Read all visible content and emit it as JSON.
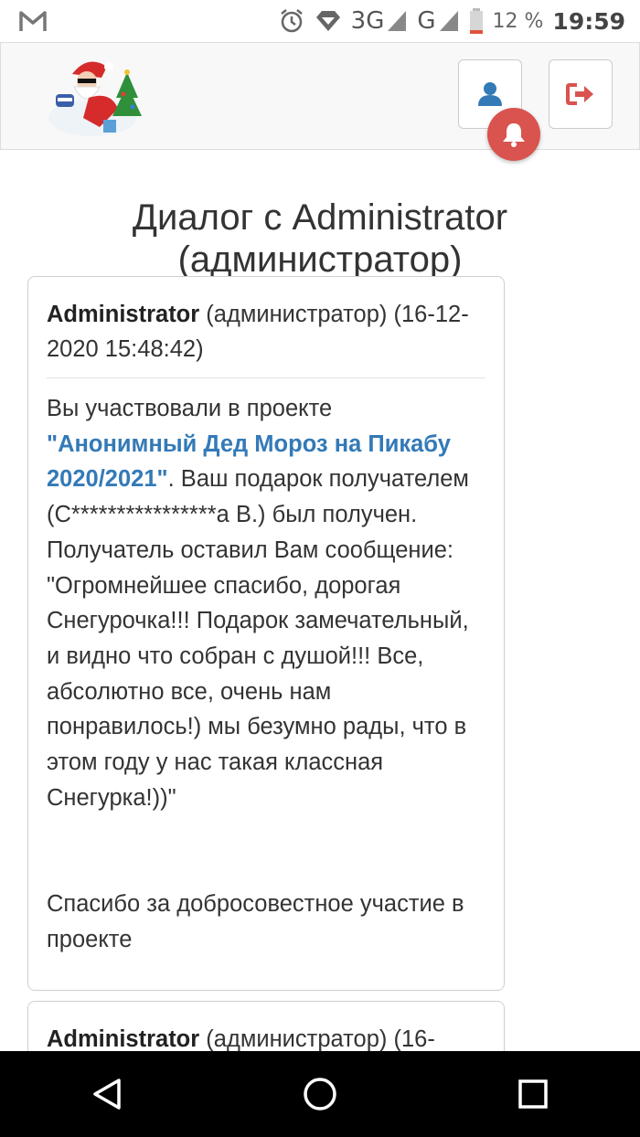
{
  "status_bar": {
    "network_3g": "3G",
    "network_g": "G",
    "battery_percent": "12 %",
    "time": "19:59"
  },
  "header": {
    "logo_icon": "santa-logo",
    "profile_icon": "user-icon",
    "logout_icon": "logout-icon",
    "notification_icon": "bell-icon",
    "notification_color": "#d9534f"
  },
  "page": {
    "title": "Диалог с Administrator (администратор)"
  },
  "messages": [
    {
      "sender": "Administrator",
      "meta": " (администратор) (16-12-2020 15:48:42)",
      "intro": "Вы участвовали в проекте ",
      "project_link": "\"Анонимный Дед Мороз на Пикабу 2020/2021\"",
      "after_link": ". Ваш подарок получателем (С****************а В.) был получен.",
      "line2": "Получатель оставил Вам сообщение: \"Огромнейшее спасибо, дорогая Снегурочка!!! Подарок замечательный, и видно что собран с душой!!! Все, абсолютно все, очень нам понравилось!) мы безумно рады, что в этом году у нас такая классная Снегурка!))\"",
      "closing": "Спасибо за добросовестное участие в проекте"
    },
    {
      "sender": "Administrator",
      "meta": " (администратор) (16-"
    }
  ],
  "colors": {
    "link": "#337ab7",
    "header_bg": "#f8f8f8",
    "nav_bg": "#000000"
  }
}
